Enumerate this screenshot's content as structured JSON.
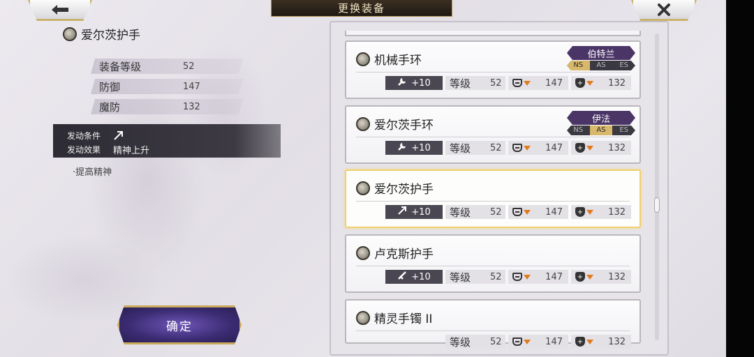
{
  "header": {
    "title": "更换装备"
  },
  "selected_item": {
    "name": "爱尔茨护手",
    "stats": [
      {
        "label": "装备等级",
        "value": "52"
      },
      {
        "label": "防御",
        "value": "147"
      },
      {
        "label": "魔防",
        "value": "132"
      }
    ],
    "trigger_label": "发动条件",
    "trigger_icon": "arrow-up-right-icon",
    "effect_label": "发动效果",
    "effect_value": "精神上升",
    "note": "·提高精神"
  },
  "confirm_label": "确定",
  "cards": [
    {
      "name": "机械手环",
      "enhance": "+10",
      "enhance_icon": "wrench-icon",
      "level_label": "等级",
      "level": "52",
      "def": "147",
      "mdef": "132",
      "tag": {
        "name": "伯特兰",
        "types": [
          "NS",
          "AS",
          "ES"
        ],
        "active": "NS"
      }
    },
    {
      "name": "爱尔茨手环",
      "enhance": "+10",
      "enhance_icon": "wrench-icon",
      "level_label": "等级",
      "level": "52",
      "def": "147",
      "mdef": "132",
      "tag": {
        "name": "伊法",
        "types": [
          "NS",
          "AS",
          "ES"
        ],
        "active": "AS"
      }
    },
    {
      "name": "爱尔茨护手",
      "enhance": "+10",
      "enhance_icon": "arrow-up-right-icon",
      "level_label": "等级",
      "level": "52",
      "def": "147",
      "mdef": "132",
      "selected": true
    },
    {
      "name": "卢克斯护手",
      "enhance": "+10",
      "enhance_icon": "sword-icon",
      "level_label": "等级",
      "level": "52",
      "def": "147",
      "mdef": "132"
    },
    {
      "name": "精灵手镯 II",
      "enhance": "",
      "enhance_icon": "",
      "level_label": "等级",
      "level": "52",
      "def": "147",
      "mdef": "132"
    }
  ],
  "colors": {
    "accent_gold": "#c9b36e",
    "selected_border": "#f1cf6b",
    "tag_purple": "#4a3566",
    "down_arrow": "#e07a1f"
  }
}
